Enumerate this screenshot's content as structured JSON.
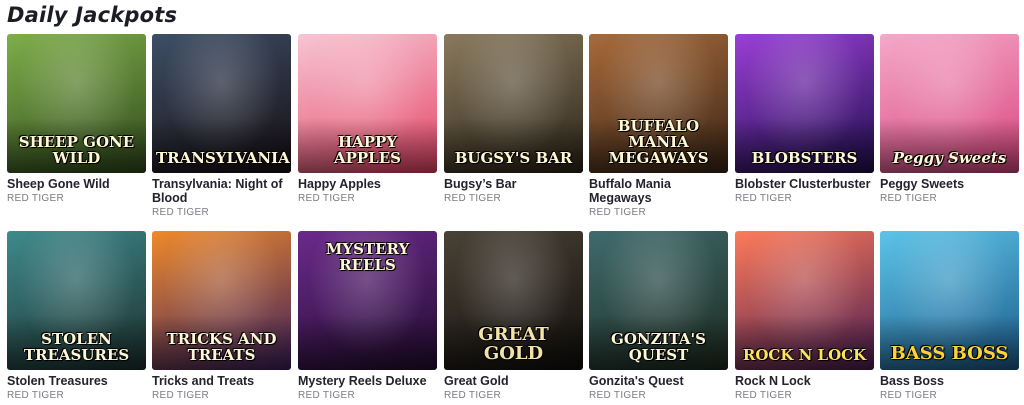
{
  "section_title": "Daily Jackpots",
  "games": [
    {
      "name": "Sheep Gone Wild",
      "provider": "RED TIGER",
      "art_text": "SHEEP GONE WILD",
      "bg": [
        "#7fae4a",
        "#2f4a1c"
      ]
    },
    {
      "name": "Transylvania: Night of Blood",
      "provider": "RED TIGER",
      "art_text": "TRANSYLVANIA",
      "bg": [
        "#3d4f66",
        "#160d12"
      ]
    },
    {
      "name": "Happy Apples",
      "provider": "RED TIGER",
      "art_text": "HAPPY APPLES",
      "bg": [
        "#f7c6d4",
        "#e64566"
      ]
    },
    {
      "name": "Bugsy’s Bar",
      "provider": "RED TIGER",
      "art_text": "BUGSY'S BAR",
      "bg": [
        "#8a7a5e",
        "#2b2418"
      ]
    },
    {
      "name": "Buffalo Mania Megaways",
      "provider": "RED TIGER",
      "art_text": "BUFFALO MANIA MEGAWAYS",
      "bg": [
        "#a86a3a",
        "#3a2516"
      ]
    },
    {
      "name": "Blobster Clusterbuster",
      "provider": "RED TIGER",
      "art_text": "BLOBSTERS",
      "bg": [
        "#9b3fd6",
        "#1f0e4e"
      ]
    },
    {
      "name": "Peggy Sweets",
      "provider": "RED TIGER",
      "art_text": "Peggy Sweets",
      "bg": [
        "#f5a9c9",
        "#d9467e"
      ]
    },
    {
      "name": "Stolen Treasures",
      "provider": "RED TIGER",
      "art_text": "STOLEN TREASURES",
      "bg": [
        "#3f8a8c",
        "#1c2f2e"
      ]
    },
    {
      "name": "Tricks and Treats",
      "provider": "RED TIGER",
      "art_text": "TRICKS and TREATS",
      "bg": [
        "#f08a2a",
        "#3b1f5e"
      ]
    },
    {
      "name": "Mystery Reels Deluxe",
      "provider": "RED TIGER",
      "art_text": "MYSTERY REELS",
      "bg": [
        "#6b2a8c",
        "#230c2f"
      ]
    },
    {
      "name": "Great Gold",
      "provider": "RED TIGER",
      "art_text": "GREAT GOLD",
      "bg": [
        "#4a4236",
        "#100e0b"
      ]
    },
    {
      "name": "Gonzita's Quest",
      "provider": "RED TIGER",
      "art_text": "GONZITA'S QUEST",
      "bg": [
        "#3f6b6e",
        "#1c2a1e"
      ]
    },
    {
      "name": "Rock N Lock",
      "provider": "RED TIGER",
      "art_text": "ROCK N LOCK",
      "bg": [
        "#ff7b5a",
        "#4a1d52"
      ]
    },
    {
      "name": "Bass Boss",
      "provider": "RED TIGER",
      "art_text": "BASS BOSS",
      "bg": [
        "#5cc4e8",
        "#1c5b8c"
      ]
    }
  ]
}
